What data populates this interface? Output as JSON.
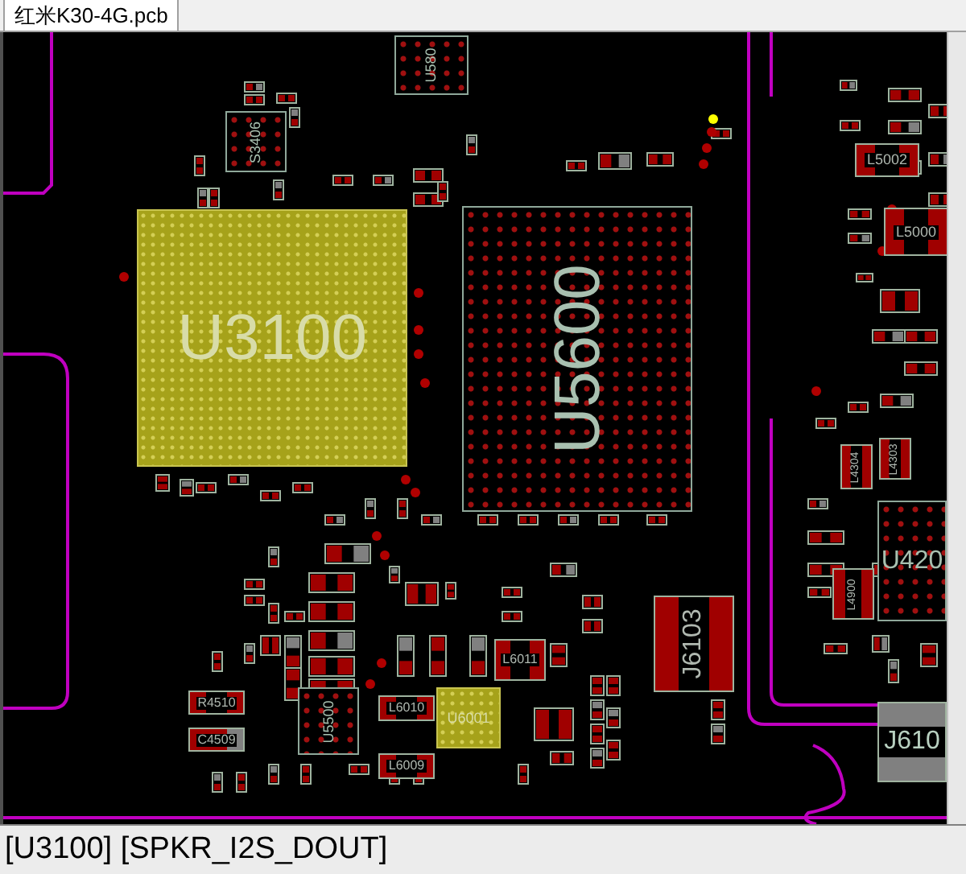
{
  "tabs": [
    {
      "label": "红米K30-4G.pcb",
      "selected": true
    }
  ],
  "board": {
    "components": [
      {
        "label": "U3100",
        "kind": "highlight_ic",
        "rotated": false
      },
      {
        "label": "U5600",
        "kind": "bga",
        "rotated": true
      },
      {
        "label": "S3406",
        "kind": "bga",
        "rotated": true
      },
      {
        "label": "U580",
        "kind": "bga",
        "rotated": true
      },
      {
        "label": "L5002",
        "kind": "inductor",
        "rotated": false
      },
      {
        "label": "L5000",
        "kind": "inductor",
        "rotated": false
      },
      {
        "label": "L4304",
        "kind": "inductor",
        "rotated": true
      },
      {
        "label": "L4303",
        "kind": "inductor",
        "rotated": true
      },
      {
        "label": "L4900",
        "kind": "inductor",
        "rotated": true
      },
      {
        "label": "U420",
        "kind": "bga",
        "rotated": false
      },
      {
        "label": "J6103",
        "kind": "inductor",
        "rotated": true
      },
      {
        "label": "J610",
        "kind": "connector",
        "rotated": false
      },
      {
        "label": "L6011",
        "kind": "inductor",
        "rotated": false
      },
      {
        "label": "L6010",
        "kind": "inductor",
        "rotated": false
      },
      {
        "label": "L6009",
        "kind": "inductor",
        "rotated": false
      },
      {
        "label": "U6001",
        "kind": "highlight_ic",
        "rotated": false
      },
      {
        "label": "R4510",
        "kind": "inductor",
        "rotated": false
      },
      {
        "label": "C4509",
        "kind": "passive",
        "rotated": false
      },
      {
        "label": "U5500",
        "kind": "bga",
        "rotated": true
      }
    ]
  },
  "status_bar": {
    "text": "[U3100] [SPKR_I2S_DOUT]"
  }
}
